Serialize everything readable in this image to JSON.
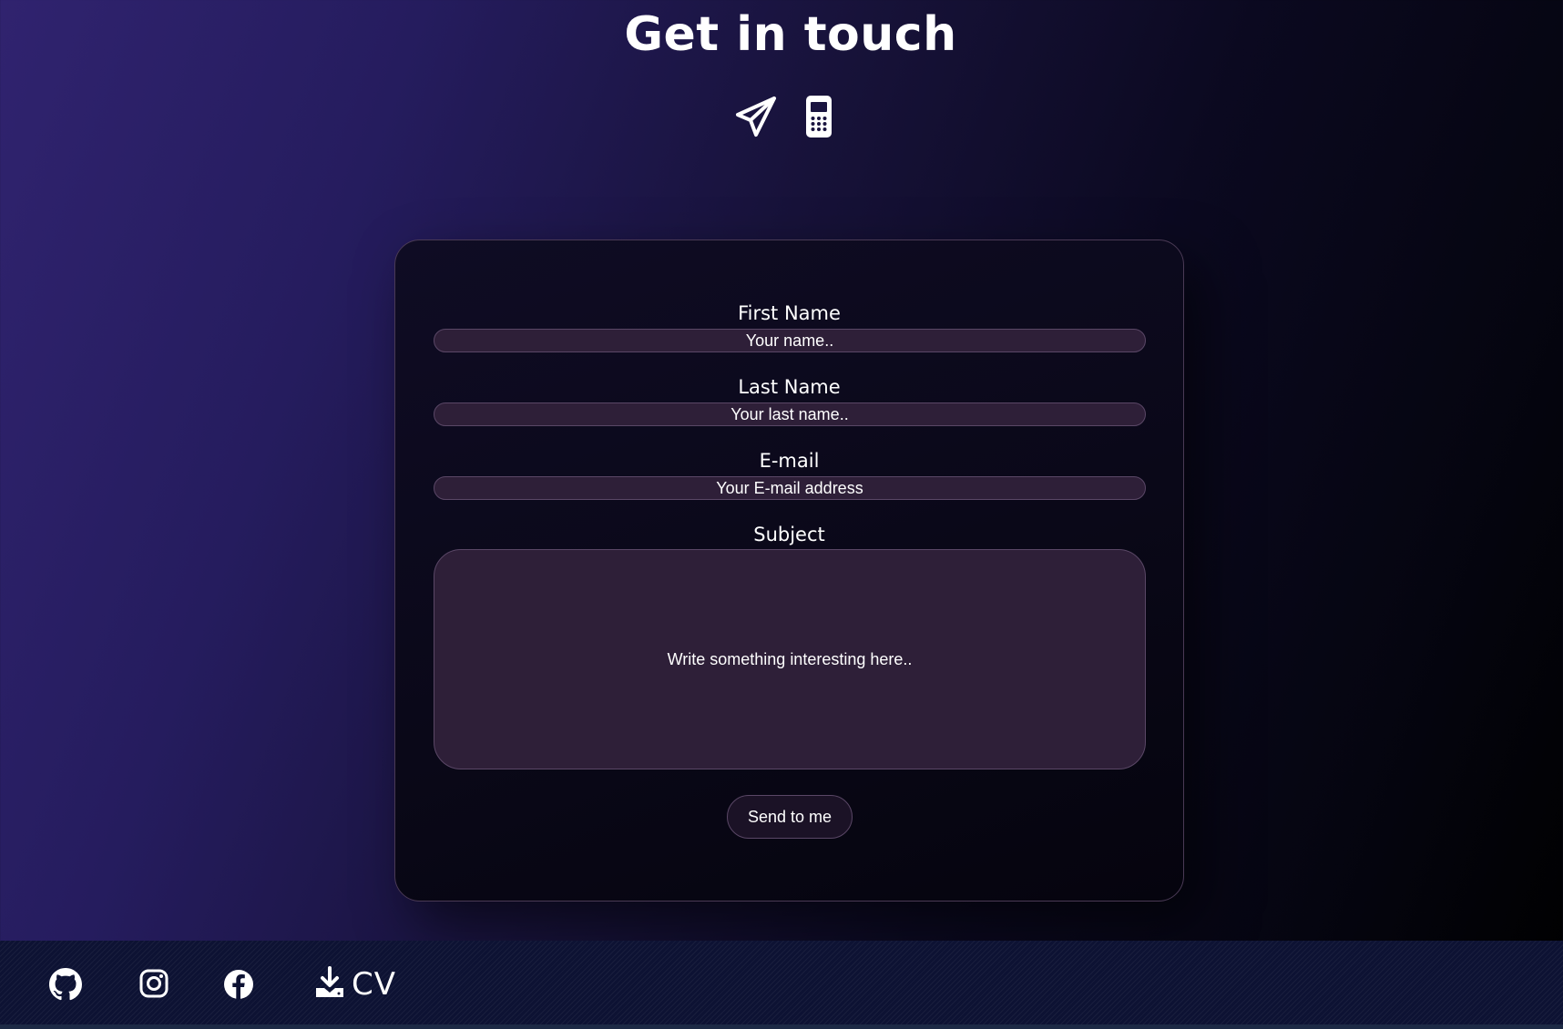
{
  "page": {
    "title": "Get in touch"
  },
  "contact_icons": [
    {
      "icon": "paper-plane-icon"
    },
    {
      "icon": "mobile-phone-icon"
    }
  ],
  "form": {
    "first_name": {
      "label": "First Name",
      "placeholder": "Your name.."
    },
    "last_name": {
      "label": "Last Name",
      "placeholder": "Your last name.."
    },
    "email": {
      "label": "E-mail",
      "placeholder": "Your E-mail address"
    },
    "subject": {
      "label": "Subject",
      "placeholder": "Write something interesting here.."
    },
    "submit_label": "Send to me"
  },
  "footer": {
    "links": [
      {
        "icon": "github-icon"
      },
      {
        "icon": "instagram-icon"
      },
      {
        "icon": "facebook-icon"
      }
    ],
    "cv": {
      "icon": "download-icon",
      "label": "CV"
    }
  },
  "colors": {
    "bg_start": "#30236f",
    "bg_end": "#000000",
    "field_bg": "#2e1f38",
    "field_border": "#5a4766",
    "footer_bg": "#0d1233"
  }
}
